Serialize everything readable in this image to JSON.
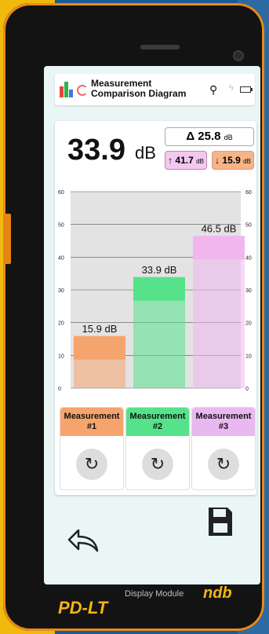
{
  "header": {
    "title": "Measurement Comparison Diagram"
  },
  "summary": {
    "current_value": "33.9",
    "current_unit": "dB",
    "delta_symbol": "Δ",
    "delta_value": "25.8",
    "delta_unit": "dB",
    "max_arrow": "↑",
    "max_value": "41.7",
    "max_unit": "dB",
    "min_arrow": "↓",
    "min_value": "15.9",
    "min_unit": "dB"
  },
  "chart_data": {
    "type": "bar",
    "categories": [
      "Measurement #1",
      "Measurement #2",
      "Measurement #3"
    ],
    "values": [
      15.9,
      33.9,
      46.5
    ],
    "value_labels": [
      "15.9 dB",
      "33.9 dB",
      "46.5 dB"
    ],
    "colors": [
      "#f6a46e",
      "#56e28a",
      "#f1b6ee"
    ],
    "ylim": [
      0,
      60
    ],
    "left_ticks": [
      "0",
      "10",
      "20",
      "30",
      "40",
      "50",
      "60"
    ],
    "right_ticks": [
      "0",
      "10",
      "20",
      "30",
      "40",
      "50",
      "60"
    ]
  },
  "cards": [
    {
      "label": "Measurement #1",
      "color": "#f6a46e"
    },
    {
      "label": "Measurement #2",
      "color": "#56e28a"
    },
    {
      "label": "Measurement #3",
      "color": "#eab8f0"
    }
  ],
  "device": {
    "module_label": "Display Module",
    "model": "PD-LT",
    "brand": "ndb"
  }
}
